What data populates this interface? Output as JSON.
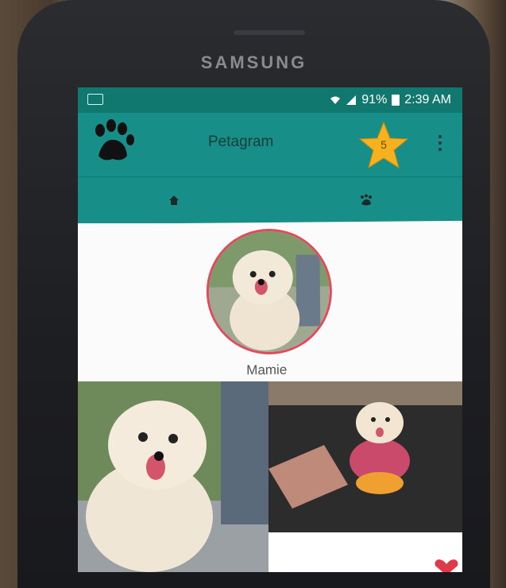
{
  "device": {
    "brand": "SAMSUNG"
  },
  "status_bar": {
    "battery": "91%",
    "time": "2:39 AM"
  },
  "app_bar": {
    "title": "Petagram",
    "star_count": "5"
  },
  "tabs": [
    {
      "icon": "home-icon"
    },
    {
      "icon": "paw-icon"
    }
  ],
  "profile": {
    "name": "Mamie"
  },
  "colors": {
    "primary": "#178f88",
    "primary_dark": "#10786f",
    "accent_star": "#f5b21e",
    "avatar_border": "#e04a5a"
  },
  "grid": [
    {
      "photo": "dog-photo-1"
    },
    {
      "photo": "dog-photo-2"
    }
  ]
}
